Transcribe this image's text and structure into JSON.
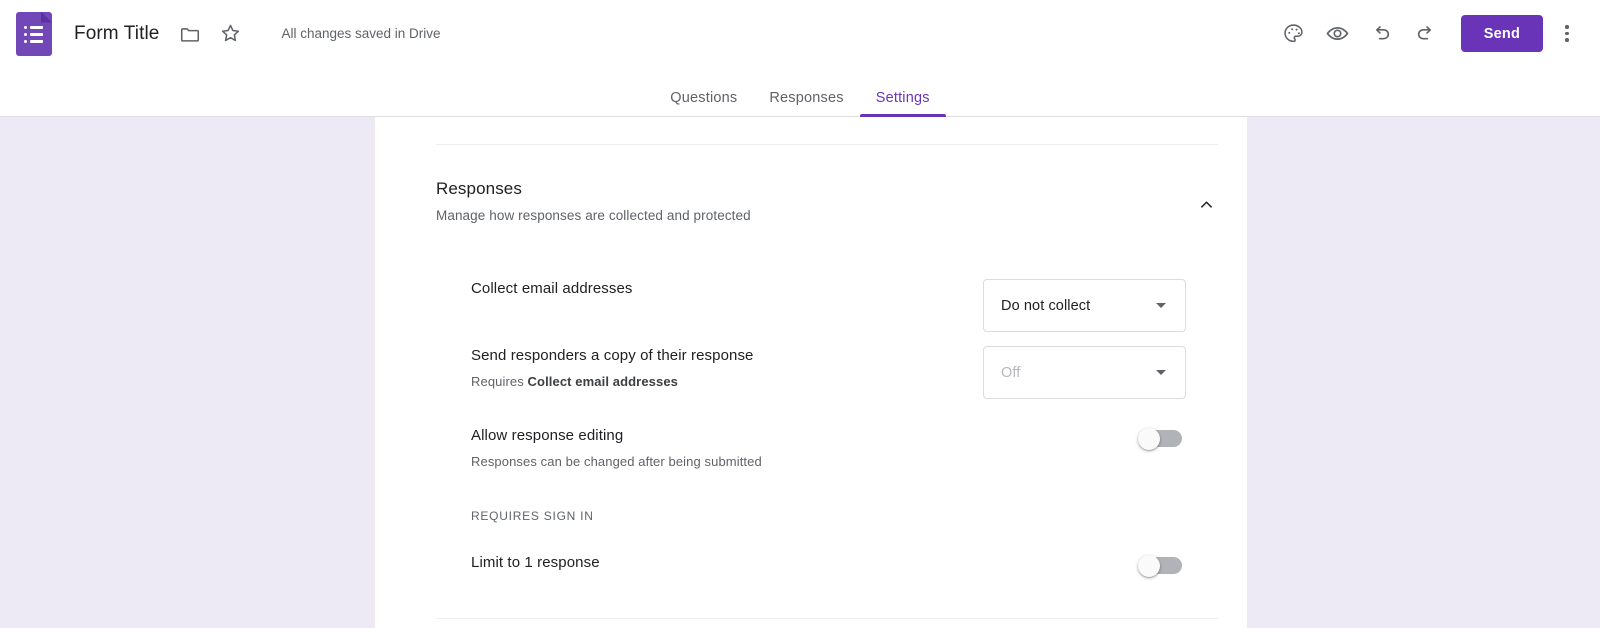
{
  "header": {
    "logo_icon": "forms-logo-icon",
    "form_title": "Form Title",
    "move_folder_icon": "folder-icon",
    "star_icon": "star-icon",
    "save_status": "All changes saved in Drive",
    "theme_icon": "palette-icon",
    "preview_icon": "eye-icon",
    "undo_icon": "undo-icon",
    "redo_icon": "redo-icon",
    "send_label": "Send",
    "more_icon": "more-vertical-icon",
    "accent_color": "#6A34B8"
  },
  "tabs": [
    {
      "label": "Questions",
      "active": false
    },
    {
      "label": "Responses",
      "active": false
    },
    {
      "label": "Settings",
      "active": true
    }
  ],
  "section": {
    "title": "Responses",
    "subtitle": "Manage how responses are collected and protected",
    "collapse_icon": "chevron-up-icon"
  },
  "settings": {
    "collect_email": {
      "label": "Collect email addresses",
      "control": "dropdown",
      "value": "Do not collect",
      "disabled": false
    },
    "send_copy": {
      "label": "Send responders a copy of their response",
      "sub_prefix": "Requires ",
      "sub_bold": "Collect email addresses",
      "control": "dropdown",
      "value": "Off",
      "disabled": true
    },
    "allow_editing": {
      "label": "Allow response editing",
      "sub": "Responses can be changed after being submitted",
      "control": "toggle",
      "value": "off"
    },
    "requires_sign_in_group": {
      "label": "REQUIRES SIGN IN"
    },
    "limit_response": {
      "label": "Limit to 1 response",
      "control": "toggle",
      "value": "off"
    }
  }
}
